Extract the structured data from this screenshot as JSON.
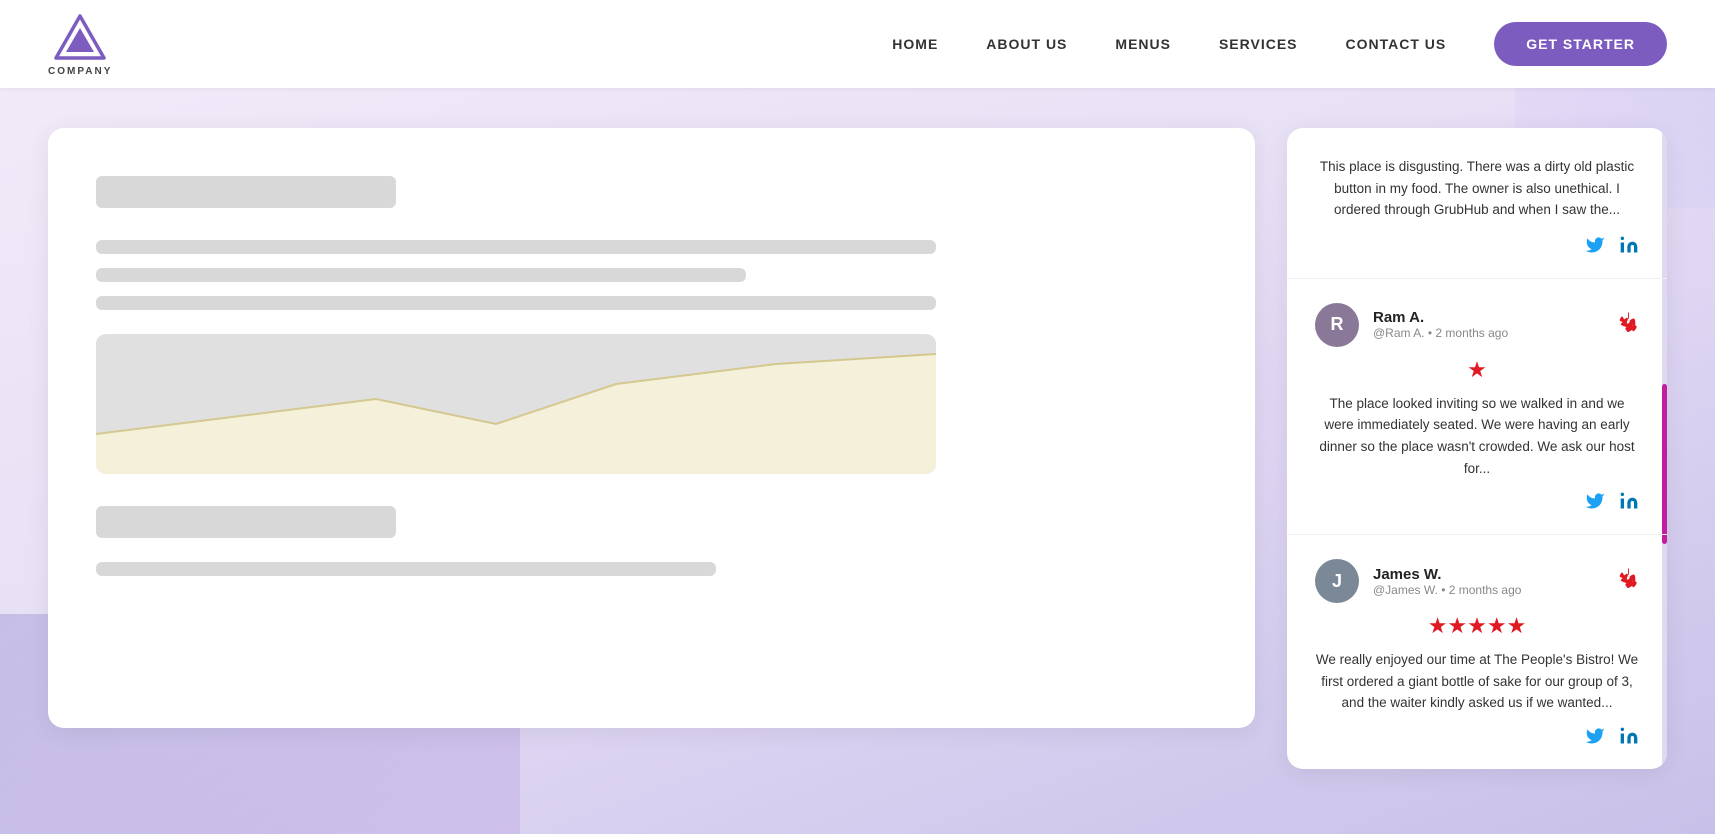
{
  "navbar": {
    "logo_label": "COMPANY",
    "links": [
      {
        "id": "home",
        "label": "HOME"
      },
      {
        "id": "about",
        "label": "ABOUT US"
      },
      {
        "id": "menus",
        "label": "MENUS"
      },
      {
        "id": "services",
        "label": "SERVICES"
      },
      {
        "id": "contact",
        "label": "CONTACT US"
      }
    ],
    "cta_label": "GET STARTER"
  },
  "reviews": [
    {
      "id": "review-top",
      "has_header": false,
      "avatar_initials": "",
      "name": "",
      "handle": "",
      "stars": 0,
      "text": "This place is disgusting. There was a dirty old plastic button in my food. The owner is also unethical. I ordered through GrubHub and when I saw the...",
      "source": "yelp"
    },
    {
      "id": "review-ram",
      "has_header": true,
      "avatar_initials": "R",
      "name": "Ram A.",
      "handle": "@Ram A. • 2 months ago",
      "stars": 1,
      "text": "The place looked inviting so we walked in and we were immediately seated. We were having an early dinner so the place wasn't crowded. We ask our host for...",
      "source": "yelp"
    },
    {
      "id": "review-james",
      "has_header": true,
      "avatar_initials": "J",
      "name": "James W.",
      "handle": "@James W. • 2 months ago",
      "stars": 5,
      "text": "We really enjoyed our time at The People's Bistro! We first ordered a giant bottle of sake for our group of 3, and the waiter kindly asked us if we wanted...",
      "source": "yelp"
    }
  ],
  "icons": {
    "twitter": "🐦",
    "linkedin": "in",
    "yelp": "y"
  }
}
